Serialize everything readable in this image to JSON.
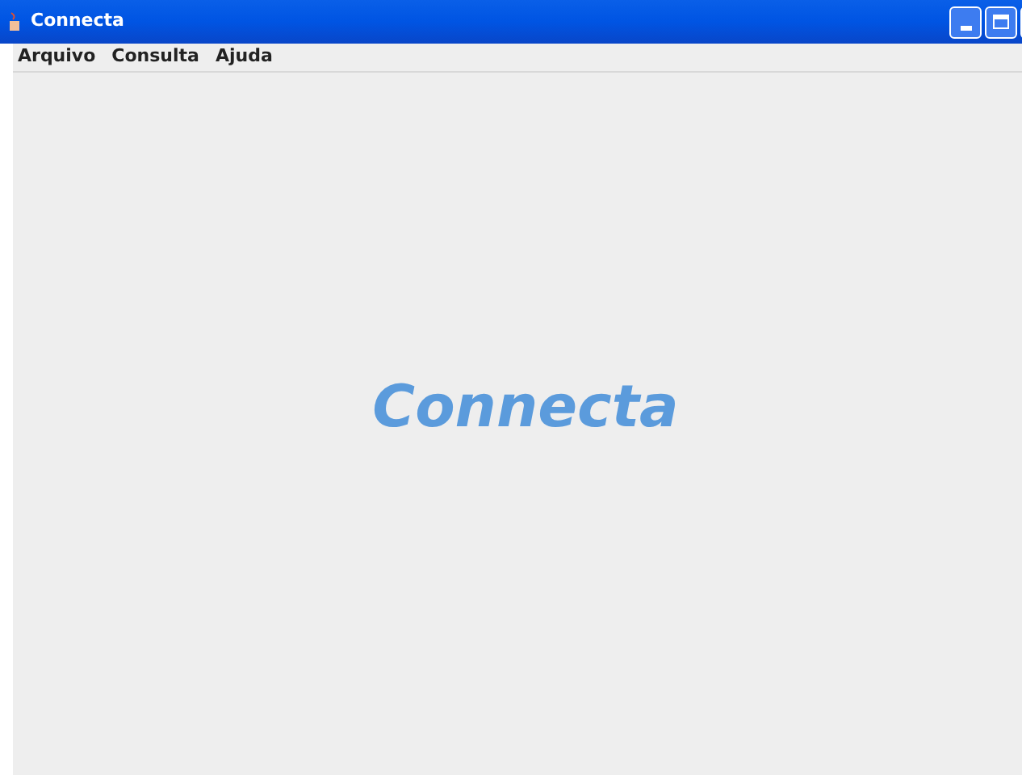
{
  "window": {
    "title": "Connecta"
  },
  "menu": [
    "Arquivo",
    "Consulta",
    "Ajuda"
  ],
  "logo_text": "Connecta"
}
